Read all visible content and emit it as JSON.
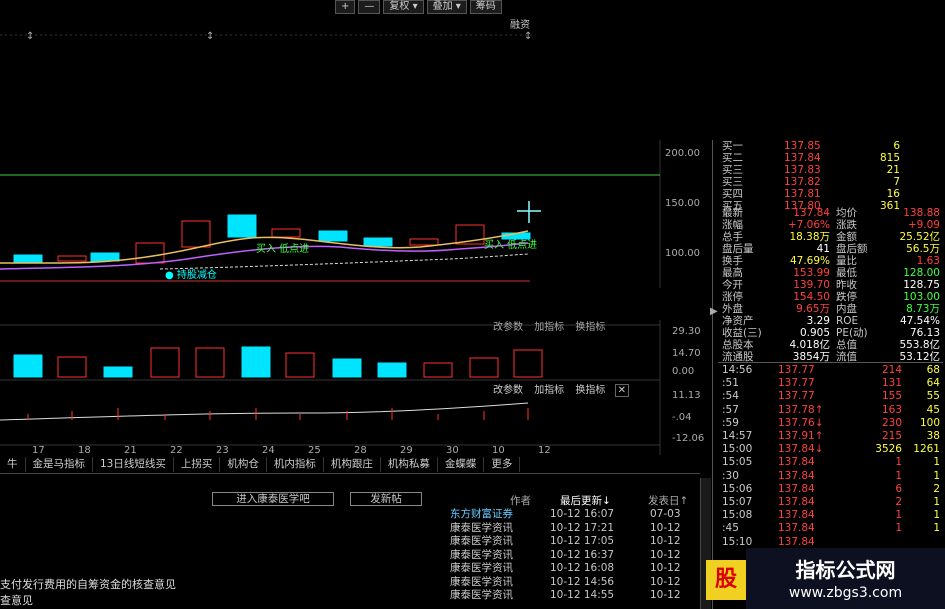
{
  "toolbar": {
    "plus": "+",
    "minus": "—",
    "fuquan": "复权",
    "diejia": "叠加",
    "choumao": "筹码",
    "rongzi": "融资"
  },
  "main_chart": {
    "y_ticks": [
      "200.00",
      "150.00",
      "100.00"
    ],
    "buy_label_1": "买入 低点进",
    "buy_label_2": "买入 低点进",
    "hold_label": "持股",
    "hold_label_2": "减仓"
  },
  "vol_chart": {
    "params": "改参数",
    "add_ind": "加指标",
    "switch_ind": "换指标",
    "y_ticks": [
      "29.30",
      "14.70",
      "0.00"
    ]
  },
  "macd_chart": {
    "params": "改参数",
    "add_ind": "加指标",
    "switch_ind": "换指标",
    "y_ticks": [
      "11.13",
      "-.04",
      "-12.06"
    ]
  },
  "x_axis": [
    "17",
    "18",
    "21",
    "22",
    "23",
    "24",
    "25",
    "28",
    "29",
    "30",
    "10",
    "12"
  ],
  "tabs": [
    "牛",
    "金是马指标",
    "13日线短线买",
    "上拐买",
    "机构仓",
    "机内指标",
    "机构跟庄",
    "机构私募",
    "金蝶蝶",
    "更多"
  ],
  "news_header": {
    "enter_bar": "进入康泰医学吧",
    "post": "发新帖",
    "author": "作者",
    "last_update": "最后更新↓",
    "post_date": "发表日↑"
  },
  "news": [
    {
      "author": "东方财富证券",
      "time": "10-12 16:07",
      "date": "07-03"
    },
    {
      "author": "康泰医学资讯",
      "time": "10-12 17:21",
      "date": "10-12"
    },
    {
      "author": "康泰医学资讯",
      "time": "10-12 17:05",
      "date": "10-12"
    },
    {
      "author": "康泰医学资讯",
      "time": "10-12 16:37",
      "date": "10-12"
    },
    {
      "author": "康泰医学资讯",
      "time": "10-12 16:08",
      "date": "10-12"
    },
    {
      "author": "康泰医学资讯",
      "time": "10-12 14:56",
      "date": "10-12"
    },
    {
      "author": "康泰医学资讯",
      "time": "10-12 14:55",
      "date": "10-12"
    }
  ],
  "news_titles": [
    "支付发行费用的自筹资金的核查意见",
    "查意见"
  ],
  "quote": {
    "bids": [
      {
        "label": "买一",
        "price": "137.85",
        "vol": "6"
      },
      {
        "label": "买二",
        "price": "137.84",
        "vol": "815"
      },
      {
        "label": "买三",
        "price": "137.83",
        "vol": "21"
      },
      {
        "label": "买三",
        "price": "137.82",
        "vol": "7"
      },
      {
        "label": "买四",
        "price": "137.81",
        "vol": "16"
      },
      {
        "label": "买五",
        "price": "137.80",
        "vol": "361"
      }
    ],
    "stats": [
      [
        "最新",
        "137.84",
        "均价",
        "138.88"
      ],
      [
        "涨幅",
        "+7.06%",
        "涨跌",
        "+9.09"
      ],
      [
        "总手",
        "18.38万",
        "金额",
        "25.52亿"
      ],
      [
        "盘后量",
        "41",
        "盘后额",
        "56.5万"
      ],
      [
        "换手",
        "47.69%",
        "量比",
        "1.63"
      ],
      [
        "最高",
        "153.99",
        "最低",
        "128.00"
      ],
      [
        "今开",
        "139.70",
        "昨收",
        "128.75"
      ],
      [
        "涨停",
        "154.50",
        "跌停",
        "103.00"
      ],
      [
        "外盘",
        "9.65万",
        "内盘",
        "8.73万"
      ],
      [
        "净资产",
        "3.29",
        "ROE",
        "47.54%"
      ],
      [
        "收益(三)",
        "0.905",
        "PE(动)",
        "76.13"
      ],
      [
        "总股本",
        "4.018亿",
        "总值",
        "553.8亿"
      ],
      [
        "流通股",
        "3854万",
        "流值",
        "53.12亿"
      ]
    ],
    "ticks": [
      {
        "t": "14:56",
        "p": "137.77",
        "v": "214",
        "n": "68"
      },
      {
        "t": ":51",
        "p": "137.77",
        "v": "131",
        "n": "64"
      },
      {
        "t": ":54",
        "p": "137.77",
        "v": "155",
        "n": "55"
      },
      {
        "t": ":57",
        "p": "137.78↑",
        "v": "163",
        "n": "45"
      },
      {
        "t": ":59",
        "p": "137.76↓",
        "v": "230",
        "n": "100"
      },
      {
        "t": "14:57",
        "p": "137.91↑",
        "v": "215",
        "n": "38"
      },
      {
        "t": "15:00",
        "p": "137.84↓",
        "v": "3526",
        "n": "1261"
      },
      {
        "t": "15:05",
        "p": "137.84",
        "v": "1",
        "n": "1"
      },
      {
        "t": ":30",
        "p": "137.84",
        "v": "1",
        "n": "1"
      },
      {
        "t": "15:06",
        "p": "137.84",
        "v": "6",
        "n": "2"
      },
      {
        "t": "15:07",
        "p": "137.84",
        "v": "2",
        "n": "1"
      },
      {
        "t": "15:08",
        "p": "137.84",
        "v": "1",
        "n": "1"
      },
      {
        "t": ":45",
        "p": "137.84",
        "v": "1",
        "n": "1"
      },
      {
        "t": "15:10",
        "p": "137.84",
        "v": "",
        "n": ""
      }
    ]
  },
  "watermark": {
    "brand1": "股",
    "brand2": "指标公式网",
    "url": "www.zbgs3.com"
  }
}
